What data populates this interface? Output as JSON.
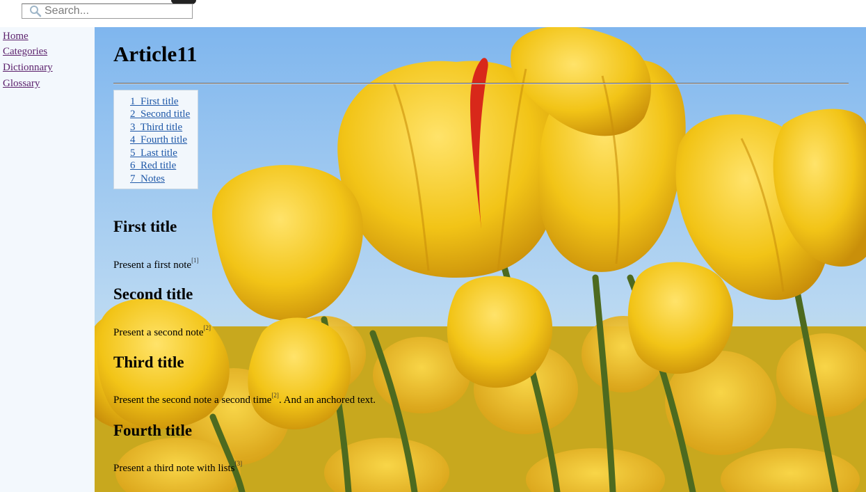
{
  "search": {
    "placeholder": "Search..."
  },
  "sidebar": {
    "items": [
      {
        "label": "Home"
      },
      {
        "label": "Categories"
      },
      {
        "label": "Dictionnary"
      },
      {
        "label": "Glossary"
      }
    ]
  },
  "article": {
    "title": "Article11",
    "toc": [
      {
        "label": "1  First title"
      },
      {
        "label": "2  Second title"
      },
      {
        "label": "3  Third title"
      },
      {
        "label": "4  Fourth title"
      },
      {
        "label": "5  Last title"
      },
      {
        "label": "6  Red title"
      },
      {
        "label": "7  Notes"
      }
    ],
    "sections": [
      {
        "heading": "First title",
        "text": "Present a first note",
        "note": "[1]"
      },
      {
        "heading": "Second title",
        "text": "Present a second note",
        "note": "[2]"
      },
      {
        "heading": "Third title",
        "text": "Present the second note a second time",
        "note": "[2]",
        "text_after": ". And an anchored text."
      },
      {
        "heading": "Fourth title",
        "text": "Present a third note with lists",
        "note": "[3]"
      }
    ]
  },
  "background": {
    "sky": "#8fc1ef",
    "petal": "#f2c417",
    "stem": "#4d6a1f",
    "accent": "#d8281a"
  }
}
